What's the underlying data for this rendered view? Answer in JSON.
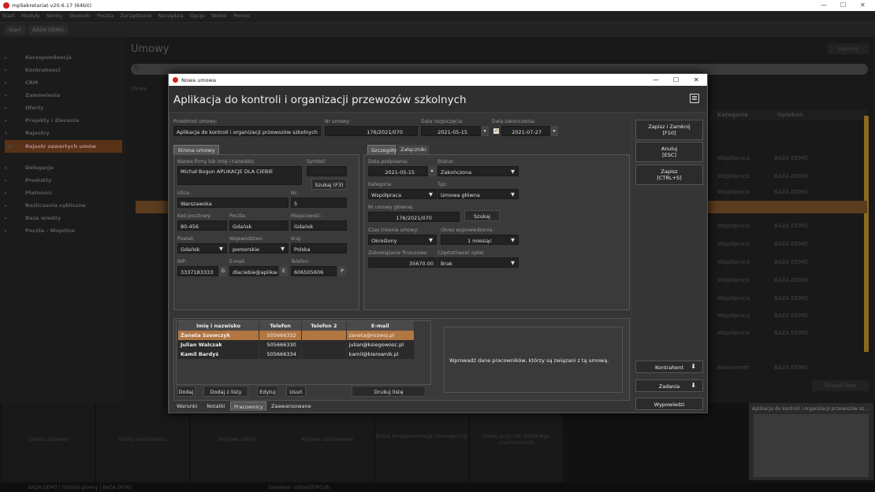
{
  "app": {
    "title": "mpSekretariat v20.6.17 (64bit)",
    "menu": [
      "Start",
      "Moduły",
      "Skróty",
      "Słowniki",
      "Poczta",
      "Zarządzanie",
      "Narzędzia",
      "Opcje",
      "Widok",
      "Pomoc"
    ],
    "tabs": [
      "Start",
      "BAZA DEMO"
    ],
    "window_controls": {
      "minimize": "—",
      "maximize": "☐",
      "close": "✕"
    }
  },
  "sidebar": {
    "items": [
      {
        "label": "Korespondencja"
      },
      {
        "label": "Kontrahenci"
      },
      {
        "label": "CRM"
      },
      {
        "label": "Zamówienia"
      },
      {
        "label": "Oferty"
      },
      {
        "label": "Projekty i Zlecenia"
      },
      {
        "label": "Rejestry"
      },
      {
        "label": "Rejestr zawartych umów"
      },
      {
        "label": "Delegacje"
      },
      {
        "label": "Produkty"
      },
      {
        "label": "Płatności"
      },
      {
        "label": "Rozliczenia cykliczne"
      },
      {
        "label": "Baza wiedzy"
      },
      {
        "label": "Poczta - Wspólne"
      }
    ]
  },
  "main": {
    "title": "Umowy",
    "close_label": "Zamknij",
    "filter_label": "Okres",
    "col_category": "Kategoria",
    "col_guardian": "Opiekun",
    "rows": [
      {
        "cat": "",
        "guard": ""
      },
      {
        "cat": "",
        "guard": ""
      },
      {
        "cat": "Współpraca",
        "guard": "BAZA DEMO"
      },
      {
        "cat": "Współpraca",
        "guard": "BAZA DEMO"
      },
      {
        "cat": "Współpraca",
        "guard": "BAZA DEMO"
      },
      {
        "cat": "Współpraca",
        "guard": "BAZA DEMO"
      },
      {
        "cat": "Współpraca",
        "guard": "BAZA DEMO"
      },
      {
        "cat": "Współpraca",
        "guard": "BAZA DEMO"
      },
      {
        "cat": "Współpraca",
        "guard": "BAZA DEMO"
      },
      {
        "cat": "Współpraca",
        "guard": "BAZA DEMO"
      },
      {
        "cat": "Współpraca",
        "guard": "BAZA DEMO"
      },
      {
        "cat": "Współpraca",
        "guard": "BAZA DEMO"
      },
      {
        "cat": "Współpraca",
        "guard": "BAZA DEMO"
      },
      {
        "cat": "Współpraca",
        "guard": "BAZA DEMO"
      },
      {
        "cat": "Abonament",
        "guard": "BAZA DEMO"
      }
    ],
    "print_list": "Drukuj listę",
    "preview_title": "Aplikacja do kontroli i organizacji przewozów sz..."
  },
  "bottom_tiles": [
    "Utwórz zadanie",
    "Dodaj kontrahenta",
    "Wystaw ofertę",
    "Wystaw zamówienie",
    "Dodaj korespondencję (zewnętrzną)",
    "Dodaj przyciski Szybkiego uruchamiania"
  ],
  "status": {
    "left": "BAZA DEMO | Oddział główny | BAZA DEMO",
    "db": "Database: sqlite/DEMO.db"
  },
  "dialog": {
    "window_title": "Nowa umowa",
    "heading": "Aplikacja do kontroli i organizacji przewozów szkolnych",
    "subject_label": "Przedmiot umowy:",
    "subject": "Aplikacja do kontroli i organizacji przewozów szkolnych",
    "number_label": "Nr umowy:",
    "number": "176/2021/070",
    "start_label": "Data rozpoczęcia:",
    "start": "2021-05-15",
    "end_label": "Data zakończenia:",
    "end": "2021-07-27",
    "party_tab": "Strona umowy",
    "party": {
      "name_label": "Nazwa firmy lub imię i nazwisko:",
      "name": "Michał Bogun APLIKACJE DLA CIEBIE",
      "symbol_label": "Symbol:",
      "search": "Szukaj (F3)",
      "street_label": "Ulica:",
      "street": "Warszawska",
      "nr_label": "Nr:",
      "nr": "5",
      "zip_label": "Kod pocztowy:",
      "zip": "80-456",
      "post_label": "Poczta:",
      "post": "Gdańsk",
      "city_label": "Miejscowość:",
      "city": "Gdańsk",
      "county_label": "Powiat:",
      "county": "Gdańsk",
      "voiv_label": "Województwo:",
      "voiv": "pomorskie",
      "country_label": "Kraj:",
      "country": "Polska",
      "nip_label": "NIP:",
      "nip": "3337183333",
      "nip_btn": "G",
      "email_label": "E-mail:",
      "email": "dlaciebie@aplikacj",
      "email_btn": "E",
      "phone_label": "Telefon:",
      "phone": "606505606",
      "phone_btn": "P"
    },
    "detail_tabs": [
      "Szczegóły",
      "Załączniki"
    ],
    "details": {
      "sign_label": "Data podpisania:",
      "sign": "2021-05-15",
      "status_label": "Status:",
      "status": "Zakończona",
      "cat_label": "Kategoria:",
      "cat": "Współpraca",
      "type_label": "Typ:",
      "type": "Umowa główna",
      "main_label": "Nr umowy głównej:",
      "main": "176/2021/070",
      "search": "Szukaj",
      "dur_label": "Czas trwania umowy:",
      "dur": "Określony",
      "notice_label": "Okres wypowiedzenia:",
      "notice": "1 miesiąc",
      "fin_label": "Zobowiązanie finansowe:",
      "fin": "35670.00",
      "freq_label": "Częstotliwość opłat:",
      "freq": "Brak"
    },
    "emp_headers": [
      "Imię i nazwisko",
      "Telefon",
      "Telefon 2",
      "E-mail"
    ],
    "employees": [
      {
        "name": "Żaneta Szewczyk",
        "phone": "505666332",
        "phone2": "",
        "email": "zaneta@rozwoj.pl"
      },
      {
        "name": "Julian Walczak",
        "phone": "505666330",
        "phone2": "",
        "email": "julian@ksiegowosc.pl"
      },
      {
        "name": "Kamil Bardyś",
        "phone": "505666334",
        "phone2": "",
        "email": "kamil@kierownik.pl"
      }
    ],
    "hint": "Wprowadź dane pracowników, którzy są związani z tą umową.",
    "emp_buttons": {
      "add": "Dodaj",
      "add_list": "Dodaj z listy",
      "edit": "Edytuj",
      "del": "Usuń",
      "print": "Drukuj listę"
    },
    "bottom_tabs": [
      "Warunki",
      "Notatki",
      "Pracownicy",
      "Zaawansowane"
    ],
    "side_buttons": {
      "save_close": "Zapisz i Zamknij",
      "save_close_key": "[F10]",
      "cancel": "Anuluj",
      "cancel_key": "[ESC]",
      "save": "Zapisz",
      "save_key": "[CTRL+S]",
      "contractor": "Kontrahent",
      "tasks": "Zadania",
      "notices": "Wypowiedzi"
    },
    "window_controls": {
      "minimize": "—",
      "maximize": "☐",
      "close": "✕"
    }
  }
}
